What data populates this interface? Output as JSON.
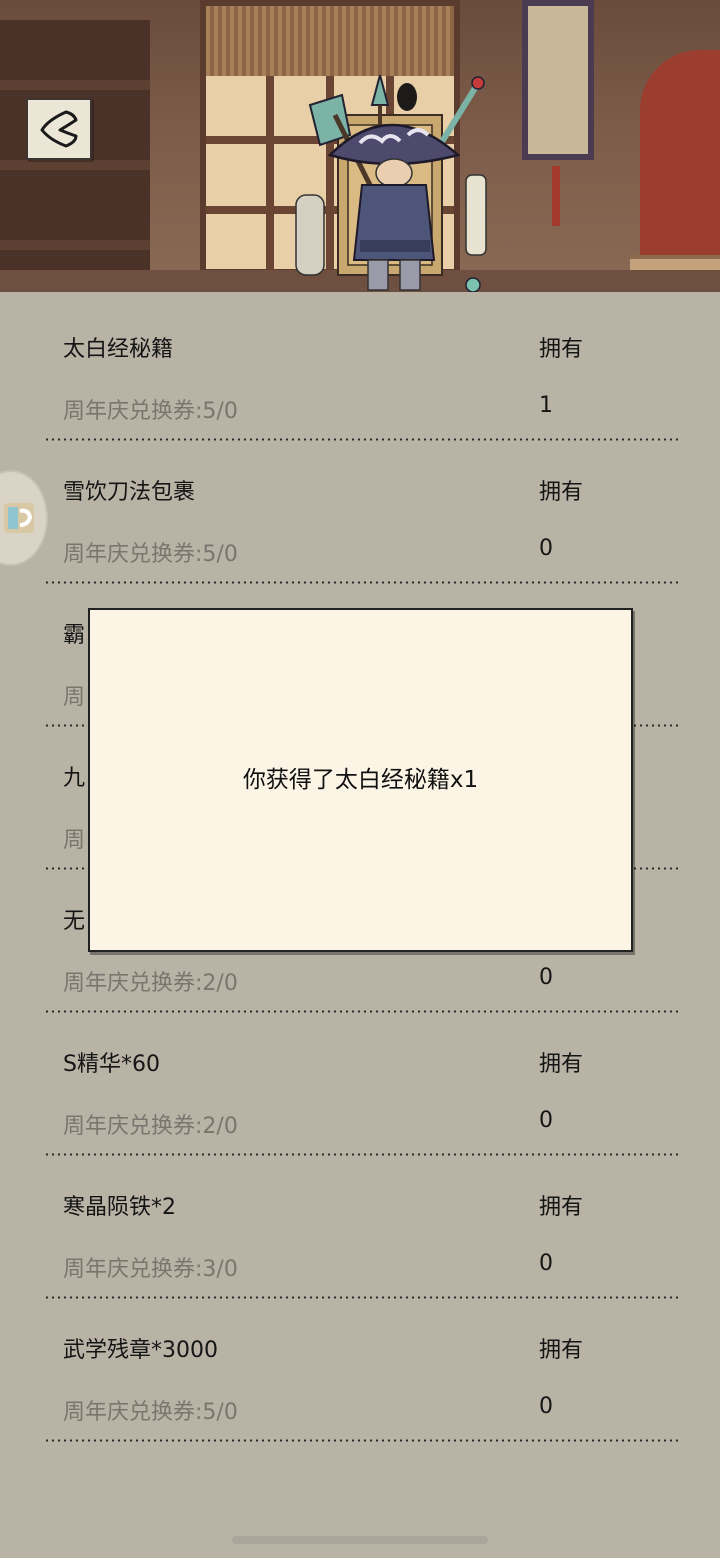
{
  "header": {
    "back_icon": "chevron-left-icon",
    "character": "traveling-merchant"
  },
  "items": [
    {
      "name": "太白经秘籍",
      "own_label": "拥有",
      "cost": "周年庆兑换券:5/0",
      "own_count": "1"
    },
    {
      "name": "雪饮刀法包裹",
      "own_label": "拥有",
      "cost": "周年庆兑换券:5/0",
      "own_count": "0"
    },
    {
      "name": "霸",
      "own_label": "",
      "cost": "周",
      "own_count": ""
    },
    {
      "name": "九",
      "own_label": "",
      "cost": "周",
      "own_count": ""
    },
    {
      "name": "无",
      "own_label": "",
      "cost": "周年庆兑换券:2/0",
      "own_count": "0"
    },
    {
      "name": "S精华*60",
      "own_label": "拥有",
      "cost": "周年庆兑换券:2/0",
      "own_count": "0"
    },
    {
      "name": "寒晶陨铁*2",
      "own_label": "拥有",
      "cost": "周年庆兑换券:3/0",
      "own_count": "0"
    },
    {
      "name": "武学残章*3000",
      "own_label": "拥有",
      "cost": "周年庆兑换券:5/0",
      "own_count": "0"
    }
  ],
  "modal": {
    "message": "你获得了太白经秘籍x1"
  },
  "colors": {
    "background": "#b9b3a6",
    "modal_background": "#fcf5e6",
    "cost_text": "#7a766d"
  }
}
